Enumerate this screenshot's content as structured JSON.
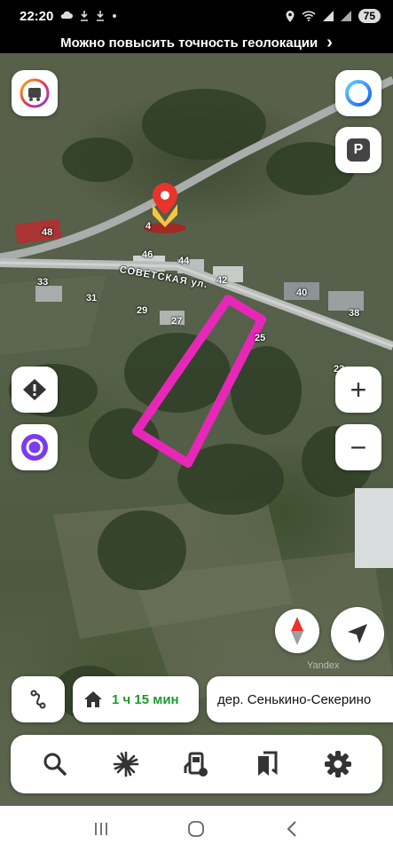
{
  "status_bar": {
    "time": "22:20",
    "left_icons": [
      "cloud-icon",
      "download-icon",
      "download-icon",
      "dot-icon"
    ],
    "right_icons": [
      "location-icon",
      "wifi-icon",
      "signal-icon",
      "signal-icon"
    ],
    "battery": "75"
  },
  "geo_banner": {
    "text": "Можно повысить точность геолокации",
    "chevron": "›"
  },
  "map": {
    "street": "СОВЕТСКАЯ ул.",
    "house_numbers": [
      "48",
      "4",
      "46",
      "44",
      "42",
      "33",
      "31",
      "29",
      "27",
      "40",
      "38",
      "25",
      "23"
    ],
    "watermark": "Yandex",
    "marker_color": "#e8342b",
    "highlight_color": "#e627b8"
  },
  "buttons": {
    "profile": "profile-icon",
    "alice_top": "alice-icon",
    "parking": "P",
    "traffic_alert": "!",
    "alice": "alice-icon",
    "zoom_in": "+",
    "zoom_out": "−",
    "compass": "compass-icon",
    "locate": "locate-icon"
  },
  "bottom": {
    "route_icon": "route-icon",
    "home_icon": "home-icon",
    "route_time": "1 ч 15 мин",
    "destination": "дер. Сенькино-Секерино"
  },
  "toolbar": [
    "search-icon",
    "discovery-icon",
    "fuel-icon",
    "bookmarks-icon",
    "settings-icon"
  ],
  "nav_bar": [
    "recent-apps-icon",
    "home-circle-icon",
    "back-icon"
  ]
}
